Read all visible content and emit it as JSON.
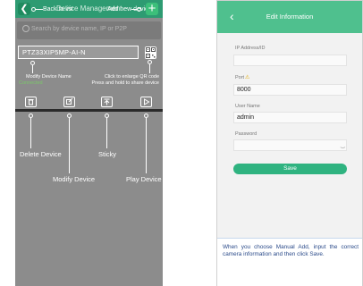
{
  "left_phone": {
    "header": {
      "back_icon": "chevron-left-icon",
      "back_label": "Back to list",
      "title": "Device Management",
      "add_label": "Add new device",
      "add_icon": "plus-icon",
      "header_color": "#2e9b72"
    },
    "search": {
      "placeholder": "Search by device name, IP or P2P"
    },
    "device": {
      "name": "PTZ33XIP5MP-AI-N",
      "status": "Connected",
      "qr_icon": "qr-code-icon"
    },
    "notes": {
      "modify_name": "Modify Device Name",
      "qr_line1": "Click to enlarge QR code",
      "qr_line2": "Press and hold to share device"
    },
    "actions": {
      "delete": "Delete Device",
      "modify": "Modify Device",
      "sticky": "Sticky",
      "play": "Play Device"
    }
  },
  "right_phone": {
    "header": {
      "back_icon": "chevron-left-icon",
      "title": "Edit Information",
      "color": "#4fc08e"
    },
    "form": {
      "ip_label": "IP Address/ID",
      "ip_value": "",
      "port_label": "Port",
      "port_value": "8000",
      "user_label": "User Name",
      "user_value": "admin",
      "password_label": "Password",
      "password_value": "",
      "save_label": "Save"
    },
    "note": "When you choose Manual Add, input the correct camera information and then click Save."
  }
}
